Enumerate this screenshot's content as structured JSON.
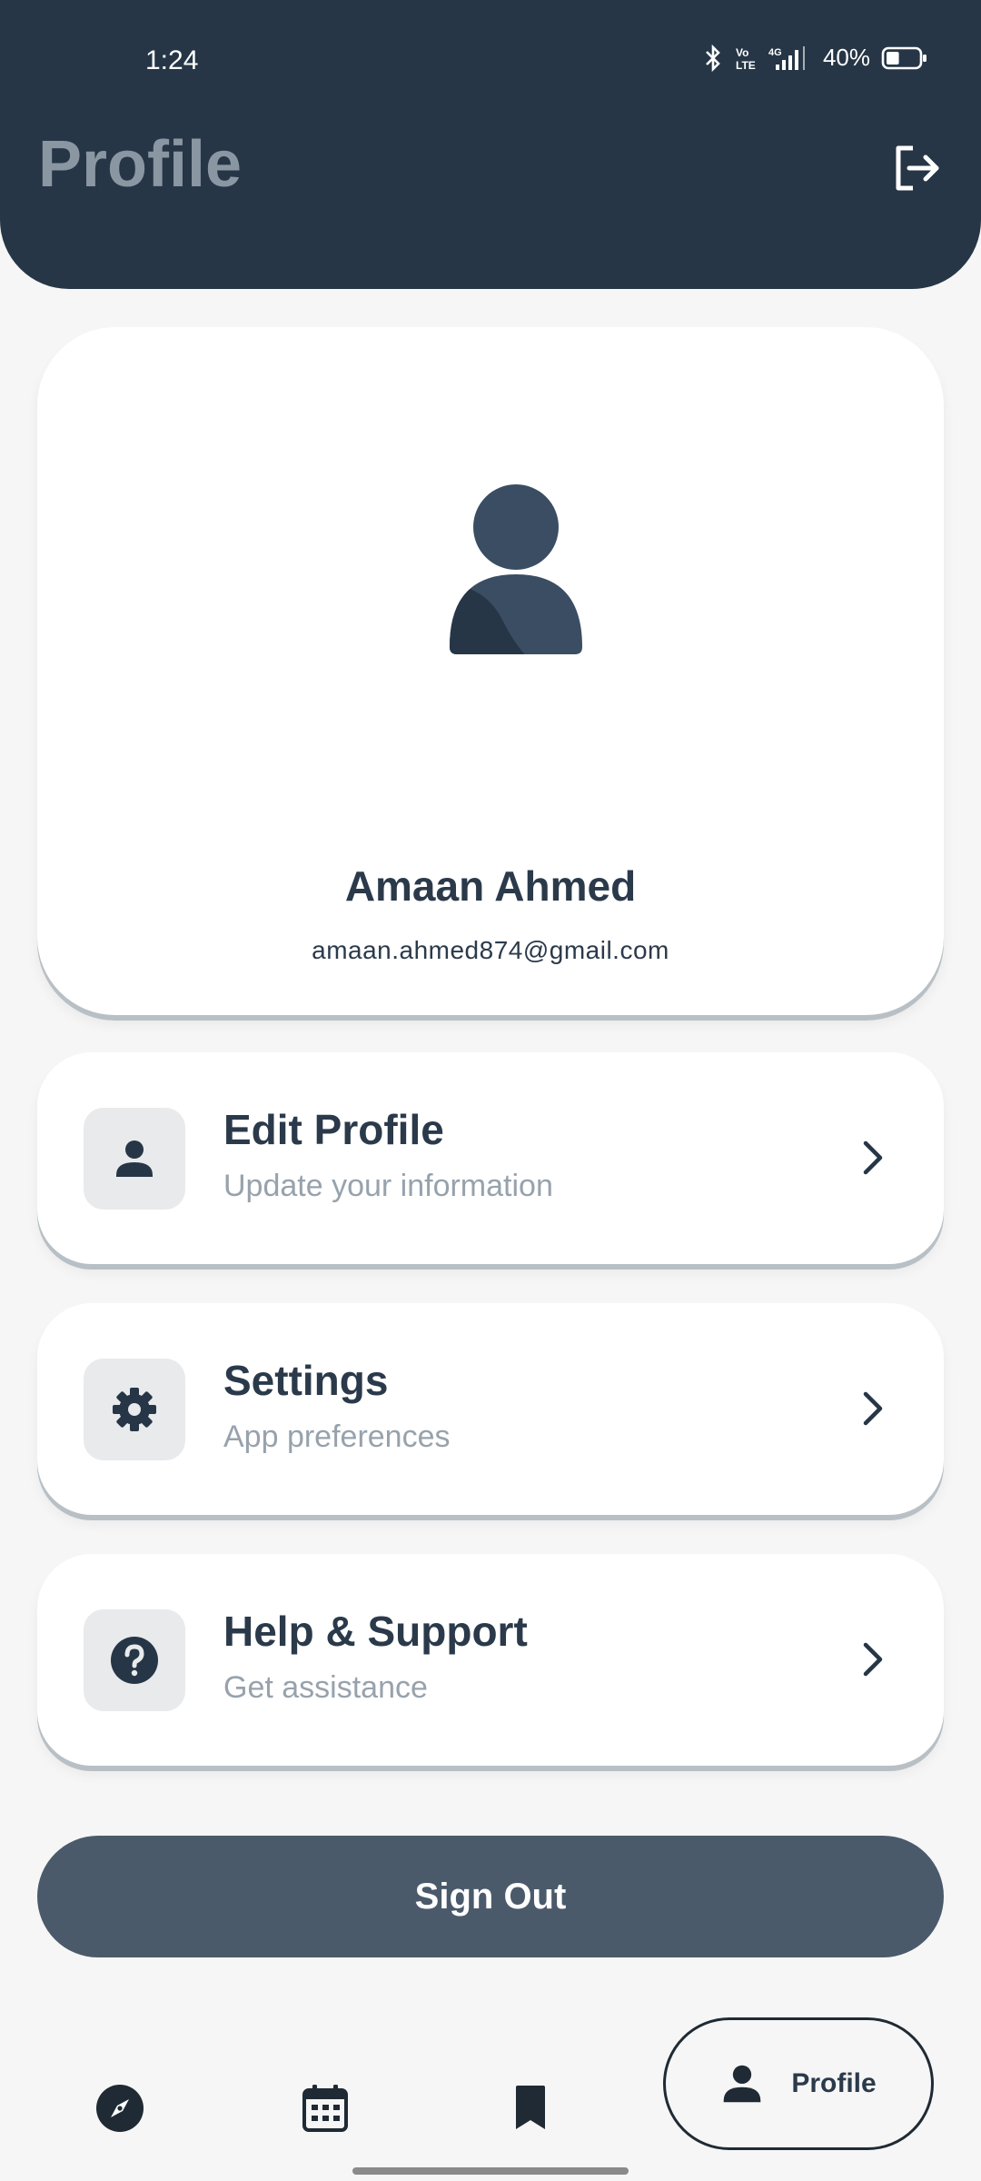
{
  "status_bar": {
    "time": "1:24",
    "battery_percent": "40%",
    "network": "4G",
    "battery_level": 0.4
  },
  "header": {
    "title": "Profile"
  },
  "profile": {
    "name": "Amaan Ahmed",
    "email": "amaan.ahmed874@gmail.com"
  },
  "menu": [
    {
      "title": "Edit Profile",
      "subtitle": "Update your information",
      "icon": "person-icon"
    },
    {
      "title": "Settings",
      "subtitle": "App preferences",
      "icon": "gear-icon"
    },
    {
      "title": "Help & Support",
      "subtitle": "Get assistance",
      "icon": "help-icon"
    }
  ],
  "sign_out_label": "Sign Out",
  "bottom_nav": {
    "items": [
      {
        "icon": "compass-icon"
      },
      {
        "icon": "calendar-icon"
      },
      {
        "icon": "bookmark-icon"
      }
    ],
    "active_label": "Profile",
    "active_icon": "person-icon"
  },
  "colors": {
    "header_bg": "#263646",
    "primary_text": "#2b3a4a",
    "secondary_text": "#97a2ac",
    "button_bg": "#4a5a6a",
    "page_bg": "#f6f6f6"
  }
}
